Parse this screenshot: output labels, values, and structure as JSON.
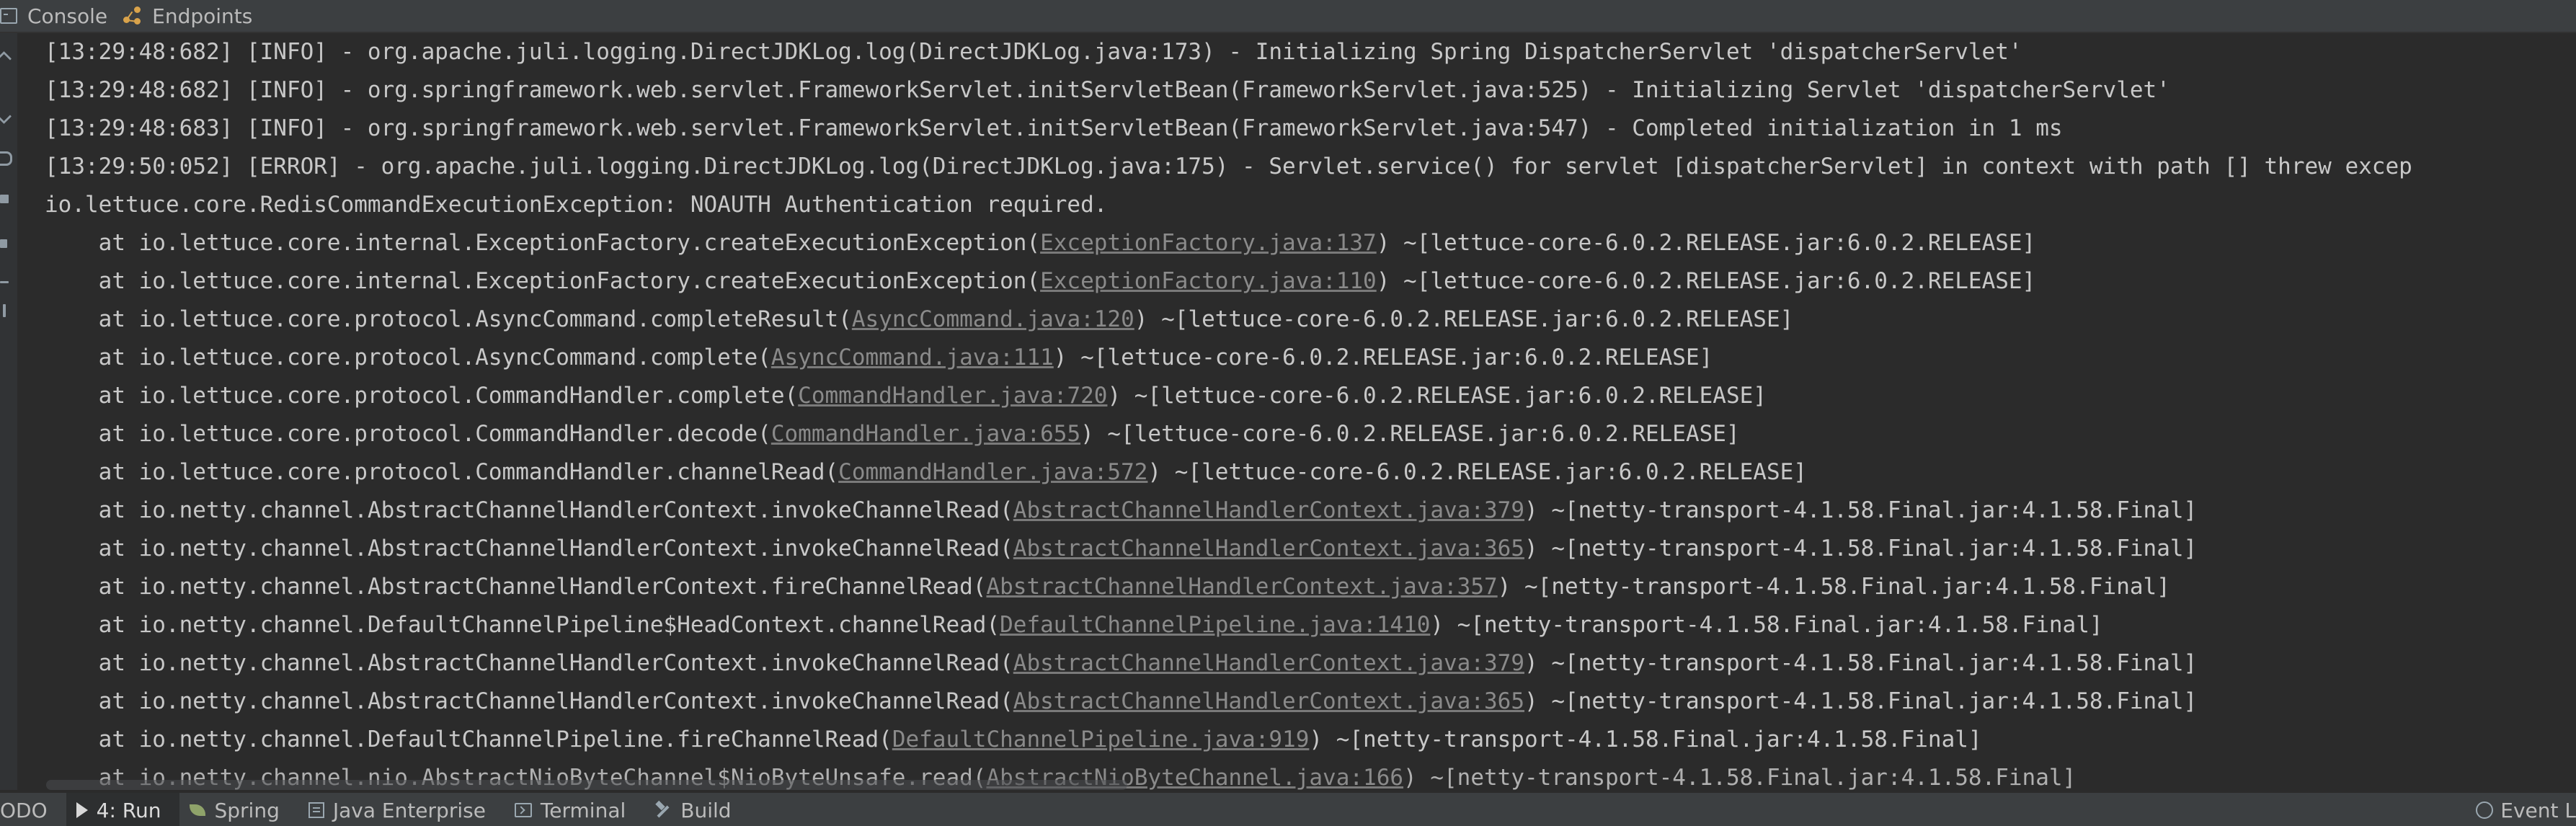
{
  "top_tabs": [
    {
      "label": "Console",
      "icon": "console-icon"
    },
    {
      "label": "Endpoints",
      "icon": "endpoints-icon"
    }
  ],
  "console": {
    "lines": [
      {
        "text": "[13:29:48:682] [INFO] - org.apache.juli.logging.DirectJDKLog.log(DirectJDKLog.java:173) - Initializing Spring DispatcherServlet 'dispatcherServlet'"
      },
      {
        "text": "[13:29:48:682] [INFO] - org.springframework.web.servlet.FrameworkServlet.initServletBean(FrameworkServlet.java:525) - Initializing Servlet 'dispatcherServlet'"
      },
      {
        "text": "[13:29:48:683] [INFO] - org.springframework.web.servlet.FrameworkServlet.initServletBean(FrameworkServlet.java:547) - Completed initialization in 1 ms"
      },
      {
        "text": "[13:29:50:052] [ERROR] - org.apache.juli.logging.DirectJDKLog.log(DirectJDKLog.java:175) - Servlet.service() for servlet [dispatcherServlet] in context with path [] threw excep"
      },
      {
        "text": "io.lettuce.core.RedisCommandExecutionException: NOAUTH Authentication required."
      }
    ],
    "stack": [
      {
        "prefix": "    at io.lettuce.core.internal.ExceptionFactory.createExecutionException(",
        "link": "ExceptionFactory.java:137",
        "suffix": ") ~[lettuce-core-6.0.2.RELEASE.jar:6.0.2.RELEASE]"
      },
      {
        "prefix": "    at io.lettuce.core.internal.ExceptionFactory.createExecutionException(",
        "link": "ExceptionFactory.java:110",
        "suffix": ") ~[lettuce-core-6.0.2.RELEASE.jar:6.0.2.RELEASE]"
      },
      {
        "prefix": "    at io.lettuce.core.protocol.AsyncCommand.completeResult(",
        "link": "AsyncCommand.java:120",
        "suffix": ") ~[lettuce-core-6.0.2.RELEASE.jar:6.0.2.RELEASE]"
      },
      {
        "prefix": "    at io.lettuce.core.protocol.AsyncCommand.complete(",
        "link": "AsyncCommand.java:111",
        "suffix": ") ~[lettuce-core-6.0.2.RELEASE.jar:6.0.2.RELEASE]"
      },
      {
        "prefix": "    at io.lettuce.core.protocol.CommandHandler.complete(",
        "link": "CommandHandler.java:720",
        "suffix": ") ~[lettuce-core-6.0.2.RELEASE.jar:6.0.2.RELEASE]"
      },
      {
        "prefix": "    at io.lettuce.core.protocol.CommandHandler.decode(",
        "link": "CommandHandler.java:655",
        "suffix": ") ~[lettuce-core-6.0.2.RELEASE.jar:6.0.2.RELEASE]"
      },
      {
        "prefix": "    at io.lettuce.core.protocol.CommandHandler.channelRead(",
        "link": "CommandHandler.java:572",
        "suffix": ") ~[lettuce-core-6.0.2.RELEASE.jar:6.0.2.RELEASE]"
      },
      {
        "prefix": "    at io.netty.channel.AbstractChannelHandlerContext.invokeChannelRead(",
        "link": "AbstractChannelHandlerContext.java:379",
        "suffix": ") ~[netty-transport-4.1.58.Final.jar:4.1.58.Final]"
      },
      {
        "prefix": "    at io.netty.channel.AbstractChannelHandlerContext.invokeChannelRead(",
        "link": "AbstractChannelHandlerContext.java:365",
        "suffix": ") ~[netty-transport-4.1.58.Final.jar:4.1.58.Final]"
      },
      {
        "prefix": "    at io.netty.channel.AbstractChannelHandlerContext.fireChannelRead(",
        "link": "AbstractChannelHandlerContext.java:357",
        "suffix": ") ~[netty-transport-4.1.58.Final.jar:4.1.58.Final]"
      },
      {
        "prefix": "    at io.netty.channel.DefaultChannelPipeline$HeadContext.channelRead(",
        "link": "DefaultChannelPipeline.java:1410",
        "suffix": ") ~[netty-transport-4.1.58.Final.jar:4.1.58.Final]"
      },
      {
        "prefix": "    at io.netty.channel.AbstractChannelHandlerContext.invokeChannelRead(",
        "link": "AbstractChannelHandlerContext.java:379",
        "suffix": ") ~[netty-transport-4.1.58.Final.jar:4.1.58.Final]"
      },
      {
        "prefix": "    at io.netty.channel.AbstractChannelHandlerContext.invokeChannelRead(",
        "link": "AbstractChannelHandlerContext.java:365",
        "suffix": ") ~[netty-transport-4.1.58.Final.jar:4.1.58.Final]"
      },
      {
        "prefix": "    at io.netty.channel.DefaultChannelPipeline.fireChannelRead(",
        "link": "DefaultChannelPipeline.java:919",
        "suffix": ") ~[netty-transport-4.1.58.Final.jar:4.1.58.Final]"
      },
      {
        "prefix": "    at io.netty.channel.nio.AbstractNioByteChannel$NioByteUnsafe.read(",
        "link": "AbstractNioByteChannel.java:166",
        "suffix": ") ~[netty-transport-4.1.58.Final.jar:4.1.58.Final]"
      }
    ]
  },
  "bottom_bar": {
    "todo_label": "ODO",
    "run_label": "4: Run",
    "spring_label": "Spring",
    "java_enterprise_label": "Java Enterprise",
    "terminal_label": "Terminal",
    "build_label": "Build",
    "event_log_label": "Event L"
  },
  "colors": {
    "background": "#2b2b2b",
    "toolbar": "#3c3f41",
    "text": "#c8c8c8",
    "link": "#8a8a8a"
  }
}
